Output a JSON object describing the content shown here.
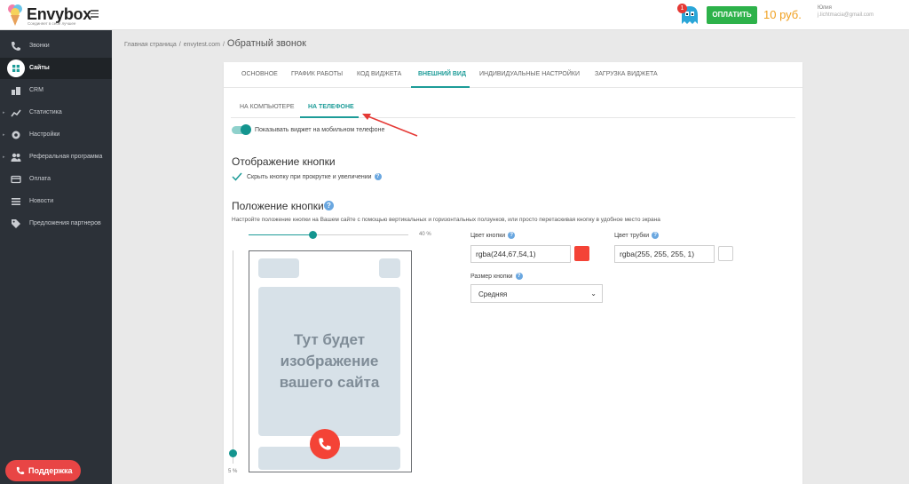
{
  "brand": {
    "name": "Envybox",
    "tagline": "Соединяет в себе лучшее"
  },
  "topbar": {
    "notification_count": "1",
    "pay_label": "ОПЛАТИТЬ",
    "balance": "10 руб.",
    "user_name": "Юлия",
    "user_email": "j.lichtmacia@gmail.com"
  },
  "sidebar": {
    "items": [
      {
        "label": "Звонки",
        "icon": "phone-icon",
        "active": false
      },
      {
        "label": "Сайты",
        "icon": "grid-icon",
        "active": true
      },
      {
        "label": "CRM",
        "icon": "crm-icon",
        "active": false
      },
      {
        "label": "Статистика",
        "icon": "chart-icon",
        "active": false
      },
      {
        "label": "Настройки",
        "icon": "gear-icon",
        "active": false
      },
      {
        "label": "Реферальная программа",
        "icon": "users-icon",
        "active": false
      },
      {
        "label": "Оплата",
        "icon": "card-icon",
        "active": false
      },
      {
        "label": "Новости",
        "icon": "list-icon",
        "active": false
      },
      {
        "label": "Предложения партнеров",
        "icon": "tag-icon",
        "active": false
      }
    ],
    "support_label": "Поддержка"
  },
  "breadcrumb": {
    "home": "Главная страница",
    "site": "envytest.com",
    "current": "Обратный звонок"
  },
  "tabs": [
    "ОСНОВНОЕ",
    "ГРАФИК РАБОТЫ",
    "КОД ВИДЖЕТА",
    "ВНЕШНИЙ ВИД",
    "ИНДИВИДУАЛЬНЫЕ НАСТРОЙКИ",
    "ЗАГРУЗКА ВИДЖЕТА"
  ],
  "active_tab": "ВНЕШНИЙ ВИД",
  "subtabs": [
    "НА КОМПЬЮТЕРЕ",
    "НА ТЕЛЕФОНЕ"
  ],
  "active_subtab": "НА ТЕЛЕФОНЕ",
  "mobile_toggle": {
    "label": "Показывать виджет на мобильном телефоне",
    "on": true
  },
  "button_display": {
    "title": "Отображение кнопки",
    "hide_label": "Скрыть кнопку при прокрутке и увеличении",
    "checked": true
  },
  "button_position": {
    "title": "Положение кнопки",
    "description": "Настройте положение кнопки на Вашем сайте с помощью вертикальных и горизонтальных ползунков, или просто перетаскивая кнопку в удобное место экрана",
    "horizontal_value": "40 %",
    "horizontal_level": 0.4,
    "vertical_value": "5 %",
    "vertical_level": 0.05,
    "placeholder_text": "Тут будет изображение вашего сайта"
  },
  "form": {
    "button_color_label": "Цвет кнопки",
    "button_color_value": "rgba(244,67,54,1)",
    "button_color_hex": "#f44336",
    "tube_color_label": "Цвет трубки",
    "tube_color_value": "rgba(255, 255, 255, 1)",
    "tube_color_hex": "#ffffff",
    "size_label": "Размер кнопки",
    "size_value": "Средняя"
  },
  "colors": {
    "accent": "#1d9c98",
    "pay": "#2db24a",
    "balance": "#f0a020",
    "sidebar": "#2c3138",
    "danger": "#e84545"
  }
}
